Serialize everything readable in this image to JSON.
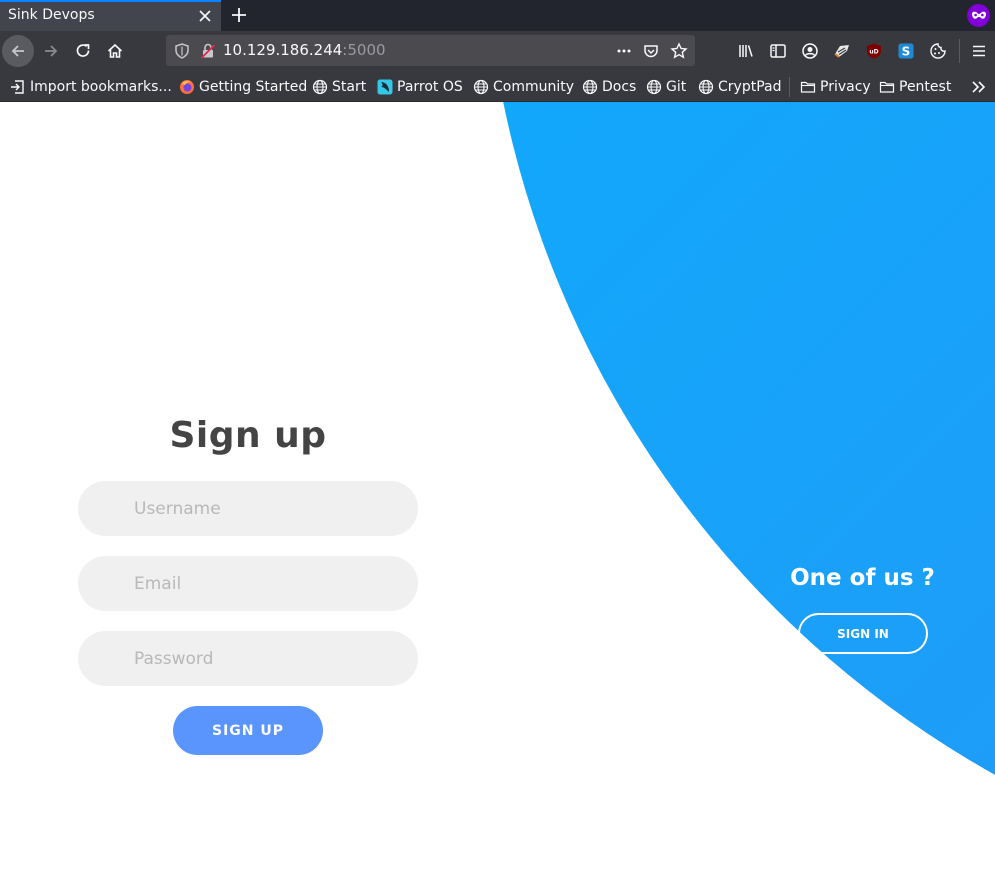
{
  "browser": {
    "tab": {
      "title": "Sink Devops"
    },
    "url": {
      "host": "10.129.186.244",
      "port": ":5000"
    },
    "bookmarks": [
      {
        "label": "Import bookmarks...",
        "icon": "import-icon"
      },
      {
        "label": "Getting Started",
        "icon": "firefox-icon"
      },
      {
        "label": "Start",
        "icon": "globe-icon"
      },
      {
        "label": "Parrot OS",
        "icon": "parrot-icon"
      },
      {
        "label": "Community",
        "icon": "globe-icon"
      },
      {
        "label": "Docs",
        "icon": "globe-icon"
      },
      {
        "label": "Git",
        "icon": "globe-icon"
      },
      {
        "label": "CryptPad",
        "icon": "globe-icon"
      },
      {
        "label": "Privacy",
        "icon": "folder-icon"
      },
      {
        "label": "Pentest",
        "icon": "folder-icon"
      }
    ],
    "accent": "#0a84ff"
  },
  "signup": {
    "title": "Sign up",
    "username_placeholder": "Username",
    "email_placeholder": "Email",
    "password_placeholder": "Password",
    "submit_label": "SIGN UP"
  },
  "panel": {
    "title": "One of us ?",
    "button_label": "SIGN IN"
  },
  "colors": {
    "primary": "#5995fd",
    "gradient_start": "#05b3fc",
    "gradient_end": "#2e8ef5",
    "field_bg": "#f0f0f0",
    "title": "#444444"
  }
}
